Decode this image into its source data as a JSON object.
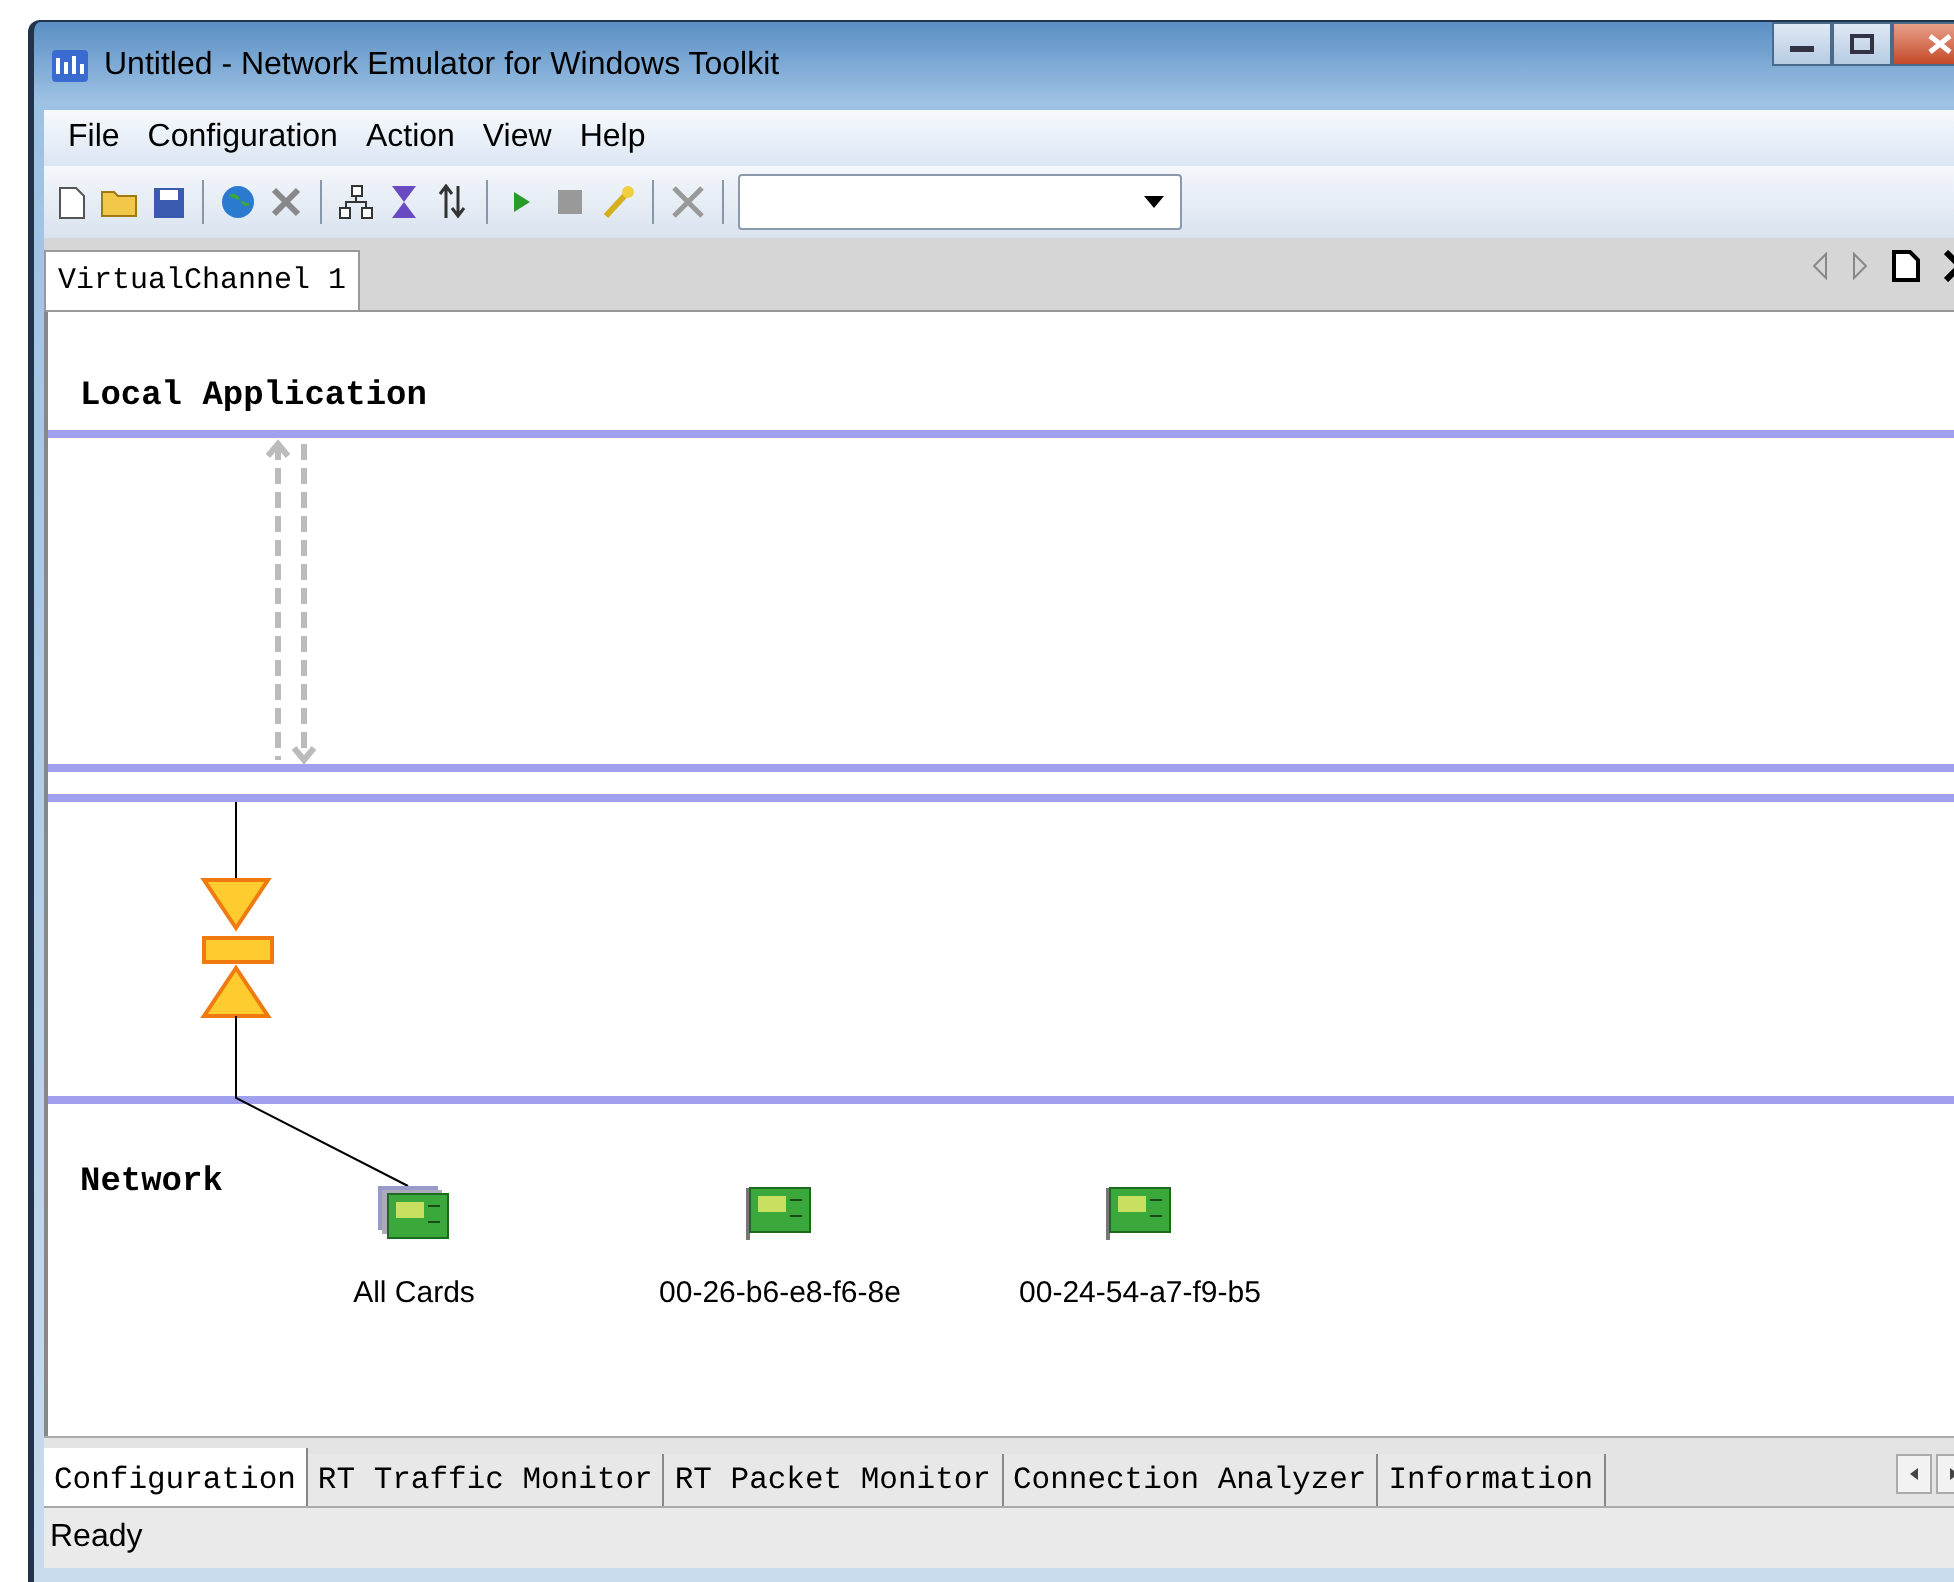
{
  "window": {
    "title": "Untitled - Network Emulator for Windows Toolkit"
  },
  "menu": [
    "File",
    "Configuration",
    "Action",
    "View",
    "Help"
  ],
  "doc_tabs": [
    {
      "label": "VirtualChannel 1",
      "selected": true
    }
  ],
  "canvas": {
    "top_lane": "Local Application",
    "bottom_lane": "Network",
    "cards": [
      {
        "label": "All Cards",
        "kind": "all"
      },
      {
        "label": "00-26-b6-e8-f6-8e",
        "kind": "single"
      },
      {
        "label": "00-24-54-a7-f9-b5",
        "kind": "single"
      }
    ]
  },
  "bottom_tabs": [
    {
      "label": "Configuration",
      "selected": true
    },
    {
      "label": "RT Traffic Monitor",
      "selected": false
    },
    {
      "label": "RT Packet Monitor",
      "selected": false
    },
    {
      "label": "Connection Analyzer",
      "selected": false
    },
    {
      "label": "Information",
      "selected": false
    }
  ],
  "status_bar": "Ready"
}
